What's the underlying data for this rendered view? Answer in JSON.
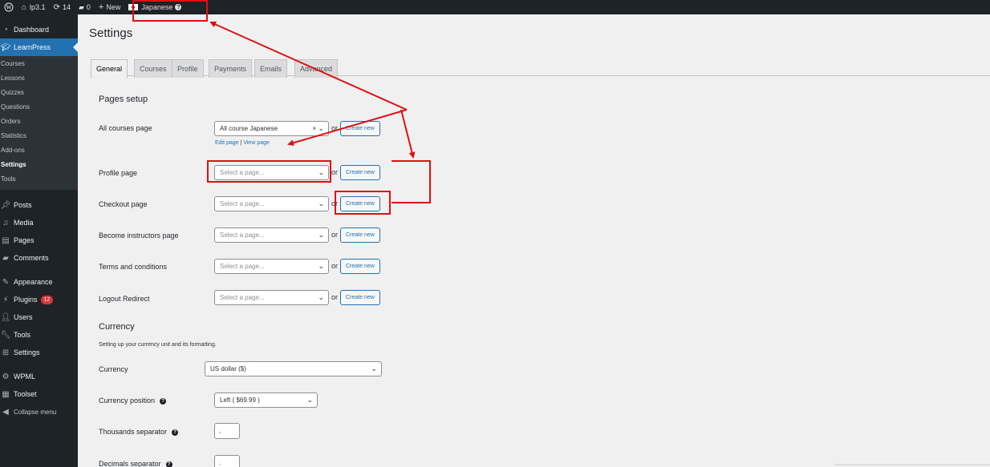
{
  "adminbar": {
    "site_name": "lp3.1",
    "updates": "14",
    "comments": "0",
    "new_label": "New",
    "language": "Japanese"
  },
  "sidebar": {
    "dashboard": "Dashboard",
    "learnpress": "LearnPress",
    "submenu": [
      "Courses",
      "Lessons",
      "Quizzes",
      "Questions",
      "Orders",
      "Statistics",
      "Add-ons",
      "Settings",
      "Tools"
    ],
    "posts": "Posts",
    "media": "Media",
    "pages": "Pages",
    "comments": "Comments",
    "appearance": "Appearance",
    "plugins": "Plugins",
    "plugins_badge": "12",
    "users": "Users",
    "tools": "Tools",
    "settings": "Settings",
    "wpml": "WPML",
    "toolset": "Toolset",
    "collapse": "Collapse menu"
  },
  "main": {
    "title": "Settings",
    "tabs": [
      "General",
      "Courses",
      "Profile",
      "Payments",
      "Emails",
      "Advanced"
    ],
    "pages_setup": {
      "heading": "Pages setup",
      "or_label": "or",
      "create_new": "Create new",
      "rows": [
        {
          "label": "All courses page",
          "value": "All course Japanese"
        },
        {
          "label": "Profile page",
          "value": "Select a page..."
        },
        {
          "label": "Checkout page",
          "value": "Select a page..."
        },
        {
          "label": "Become instructors page",
          "value": "Select a page..."
        },
        {
          "label": "Terms and conditions",
          "value": "Select a page..."
        },
        {
          "label": "Logout Redirect",
          "value": "Select a page..."
        }
      ],
      "edit_page": "Edit page",
      "link_sep": "|",
      "view_page": "View page"
    },
    "currency": {
      "heading": "Currency",
      "description": "Setting up your currency unit and its formatting.",
      "currency_label": "Currency",
      "currency_value": "US dollar ($)",
      "position_label": "Currency position",
      "position_value": "Left ( $69.99 )",
      "thousands_label": "Thousands separator",
      "thousands_value": ",",
      "decimals_label": "Decimals separator",
      "decimals_value": "."
    }
  },
  "colors": {
    "annotation_red": "#e01010",
    "admin_dark": "#1d2327",
    "accent_blue": "#2271b1"
  }
}
